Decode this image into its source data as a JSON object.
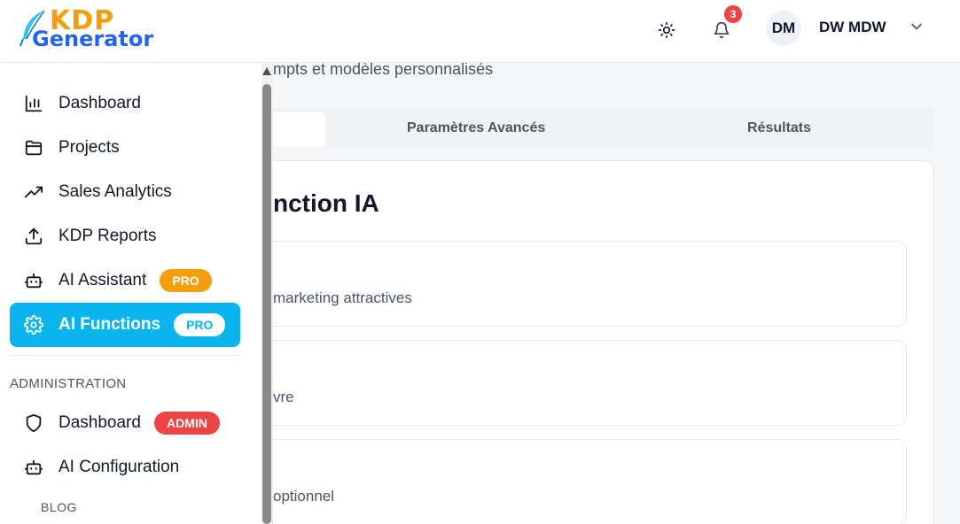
{
  "brand": {
    "logo_top": "KDP",
    "logo_bottom": "Generator"
  },
  "header": {
    "notifications_count": "3",
    "avatar_initials": "DM",
    "user_name": "DW MDW"
  },
  "sidebar": {
    "items": [
      {
        "label": "Dashboard",
        "icon": "bar-chart-icon"
      },
      {
        "label": "Projects",
        "icon": "folder-icon"
      },
      {
        "label": "Sales Analytics",
        "icon": "trending-up-icon"
      },
      {
        "label": "KDP Reports",
        "icon": "upload-icon"
      },
      {
        "label": "AI Assistant",
        "icon": "bot-icon",
        "badge": "PRO"
      },
      {
        "label": "AI Functions",
        "icon": "gear-icon",
        "badge": "PRO",
        "active": true
      }
    ],
    "admin_section_title": "ADMINISTRATION",
    "admin_items": [
      {
        "label": "Dashboard",
        "icon": "shield-icon",
        "badge": "ADMIN"
      },
      {
        "label": "AI Configuration",
        "icon": "bot-icon"
      }
    ],
    "blog_title": "BLOG"
  },
  "main": {
    "subtitle": "mpts et modèles personnalisés",
    "tabs": [
      {
        "label": "",
        "active": true
      },
      {
        "label": "Paramètres Avancés"
      },
      {
        "label": "Résultats"
      }
    ],
    "card_title": "nction IA",
    "options": [
      {
        "text": "marketing attractives"
      },
      {
        "text": "vre"
      },
      {
        "text": "optionnel"
      }
    ]
  },
  "colors": {
    "accent": "#0ab4ec",
    "pro_badge": "#f59e0b",
    "admin_badge": "#ef4444",
    "notification": "#ef4444",
    "logo_orange": "#f59e0b",
    "logo_blue": "#2563eb"
  }
}
